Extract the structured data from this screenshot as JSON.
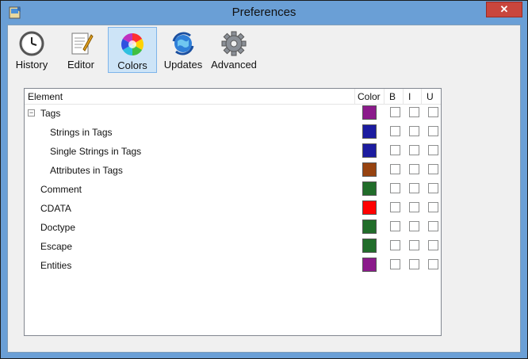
{
  "window": {
    "title": "Preferences",
    "close_glyph": "✕"
  },
  "toolbar": {
    "items": [
      {
        "label": "History",
        "icon": "clock-icon"
      },
      {
        "label": "Editor",
        "icon": "notepad-icon"
      },
      {
        "label": "Colors",
        "icon": "color-wheel-icon",
        "active": true
      },
      {
        "label": "Updates",
        "icon": "globe-update-icon"
      },
      {
        "label": "Advanced",
        "icon": "gear-icon"
      }
    ]
  },
  "table": {
    "headers": {
      "element": "Element",
      "color": "Color",
      "bold": "B",
      "italic": "I",
      "underline": "U"
    },
    "rows": [
      {
        "name": "Tags",
        "color": "#8b1a8b",
        "level": 0,
        "expander": "−",
        "bold": false,
        "italic": false,
        "underline": false
      },
      {
        "name": "Strings in Tags",
        "color": "#1c1ca0",
        "level": 1,
        "bold": false,
        "italic": false,
        "underline": false
      },
      {
        "name": "Single Strings in Tags",
        "color": "#1c1ca0",
        "level": 1,
        "bold": false,
        "italic": false,
        "underline": false
      },
      {
        "name": "Attributes in Tags",
        "color": "#974310",
        "level": 1,
        "bold": false,
        "italic": false,
        "underline": false
      },
      {
        "name": "Comment",
        "color": "#216d2a",
        "level": 0,
        "bold": false,
        "italic": false,
        "underline": false
      },
      {
        "name": "CDATA",
        "color": "#ff0000",
        "level": 0,
        "bold": false,
        "italic": false,
        "underline": false
      },
      {
        "name": "Doctype",
        "color": "#216d2a",
        "level": 0,
        "bold": false,
        "italic": false,
        "underline": false
      },
      {
        "name": "Escape",
        "color": "#216d2a",
        "level": 0,
        "bold": false,
        "italic": false,
        "underline": false
      },
      {
        "name": "Entities",
        "color": "#8b1a8b",
        "level": 0,
        "bold": false,
        "italic": false,
        "underline": false
      }
    ]
  },
  "colors": {
    "titlebar": "#6a9fd6",
    "active_tab": "#cde4f7",
    "close": "#c9463d"
  }
}
